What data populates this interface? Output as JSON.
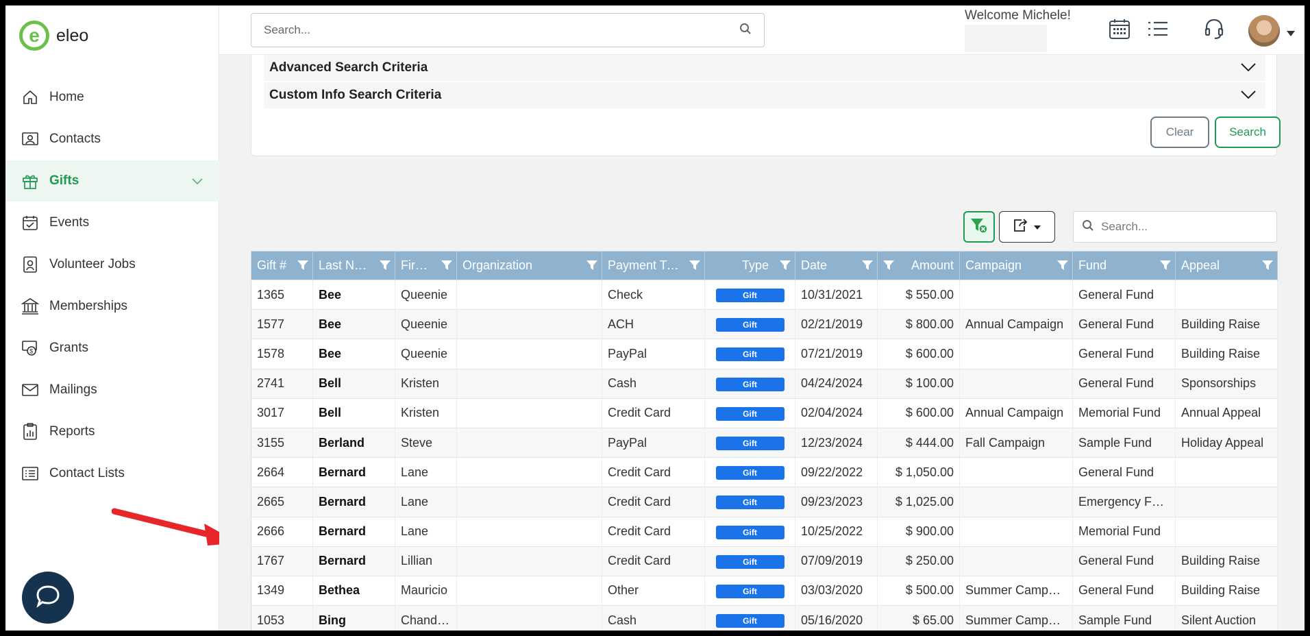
{
  "app": {
    "name": "eleo",
    "logo_letter": "e"
  },
  "sidebar": {
    "items": [
      {
        "label": "Home",
        "icon": "home-icon"
      },
      {
        "label": "Contacts",
        "icon": "contacts-icon"
      },
      {
        "label": "Gifts",
        "icon": "gift-icon",
        "active": true
      },
      {
        "label": "Events",
        "icon": "calendar-check-icon"
      },
      {
        "label": "Volunteer Jobs",
        "icon": "badge-icon"
      },
      {
        "label": "Memberships",
        "icon": "bank-icon"
      },
      {
        "label": "Grants",
        "icon": "money-icon"
      },
      {
        "label": "Mailings",
        "icon": "envelope-icon"
      },
      {
        "label": "Reports",
        "icon": "report-icon"
      },
      {
        "label": "Contact Lists",
        "icon": "list-icon"
      }
    ]
  },
  "topbar": {
    "search_placeholder": "Search...",
    "welcome": "Welcome Michele!"
  },
  "criteria": {
    "advanced": "Advanced Search Criteria",
    "custom": "Custom Info Search Criteria",
    "clear_label": "Clear",
    "search_label": "Search"
  },
  "grid_search_placeholder": "Search...",
  "table": {
    "columns": [
      "Gift #",
      "Last Na...",
      "First ...",
      "Organization",
      "Payment Type",
      "Type",
      "Date",
      "Amount",
      "Campaign",
      "Fund",
      "Appeal"
    ],
    "rows": [
      [
        "1365",
        "Bee",
        "Queenie",
        "",
        "Check",
        "Gift",
        "10/31/2021",
        "$ 550.00",
        "",
        "General Fund",
        ""
      ],
      [
        "1577",
        "Bee",
        "Queenie",
        "",
        "ACH",
        "Gift",
        "02/21/2019",
        "$ 800.00",
        "Annual Campaign",
        "General Fund",
        "Building Raise"
      ],
      [
        "1578",
        "Bee",
        "Queenie",
        "",
        "PayPal",
        "Gift",
        "07/21/2019",
        "$ 600.00",
        "",
        "General Fund",
        "Building Raise"
      ],
      [
        "2741",
        "Bell",
        "Kristen",
        "",
        "Cash",
        "Gift",
        "04/24/2024",
        "$ 100.00",
        "",
        "General Fund",
        "Sponsorships"
      ],
      [
        "3017",
        "Bell",
        "Kristen",
        "",
        "Credit Card",
        "Gift",
        "02/04/2024",
        "$ 600.00",
        "Annual Campaign",
        "Memorial Fund",
        "Annual Appeal"
      ],
      [
        "3155",
        "Berland",
        "Steve",
        "",
        "PayPal",
        "Gift",
        "12/23/2024",
        "$ 444.00",
        "Fall Campaign",
        "Sample Fund",
        "Holiday Appeal"
      ],
      [
        "2664",
        "Bernard",
        "Lane",
        "",
        "Credit Card",
        "Gift",
        "09/22/2022",
        "$ 1,050.00",
        "",
        "General Fund",
        ""
      ],
      [
        "2665",
        "Bernard",
        "Lane",
        "",
        "Credit Card",
        "Gift",
        "09/23/2023",
        "$ 1,025.00",
        "",
        "Emergency Fund",
        ""
      ],
      [
        "2666",
        "Bernard",
        "Lane",
        "",
        "Credit Card",
        "Gift",
        "10/25/2022",
        "$ 900.00",
        "",
        "Memorial Fund",
        ""
      ],
      [
        "1767",
        "Bernard",
        "Lillian",
        "",
        "Credit Card",
        "Gift",
        "07/09/2019",
        "$ 250.00",
        "",
        "General Fund",
        "Building Raise"
      ],
      [
        "1349",
        "Bethea",
        "Mauricio",
        "",
        "Other",
        "Gift",
        "03/03/2020",
        "$ 500.00",
        "Summer Campai...",
        "General Fund",
        "Building Raise"
      ],
      [
        "1053",
        "Bing",
        "Chandler",
        "",
        "Cash",
        "Gift",
        "05/16/2020",
        "$ 65.00",
        "Summer Campai...",
        "Sample Fund",
        "Silent Auction"
      ]
    ]
  },
  "colors": {
    "accent_green": "#1f9a55",
    "logo_green": "#6cc04a",
    "header_blue": "#8fb2cf",
    "badge_blue": "#1a73e8",
    "chat_navy": "#15324f",
    "arrow_red": "#e8262a"
  }
}
